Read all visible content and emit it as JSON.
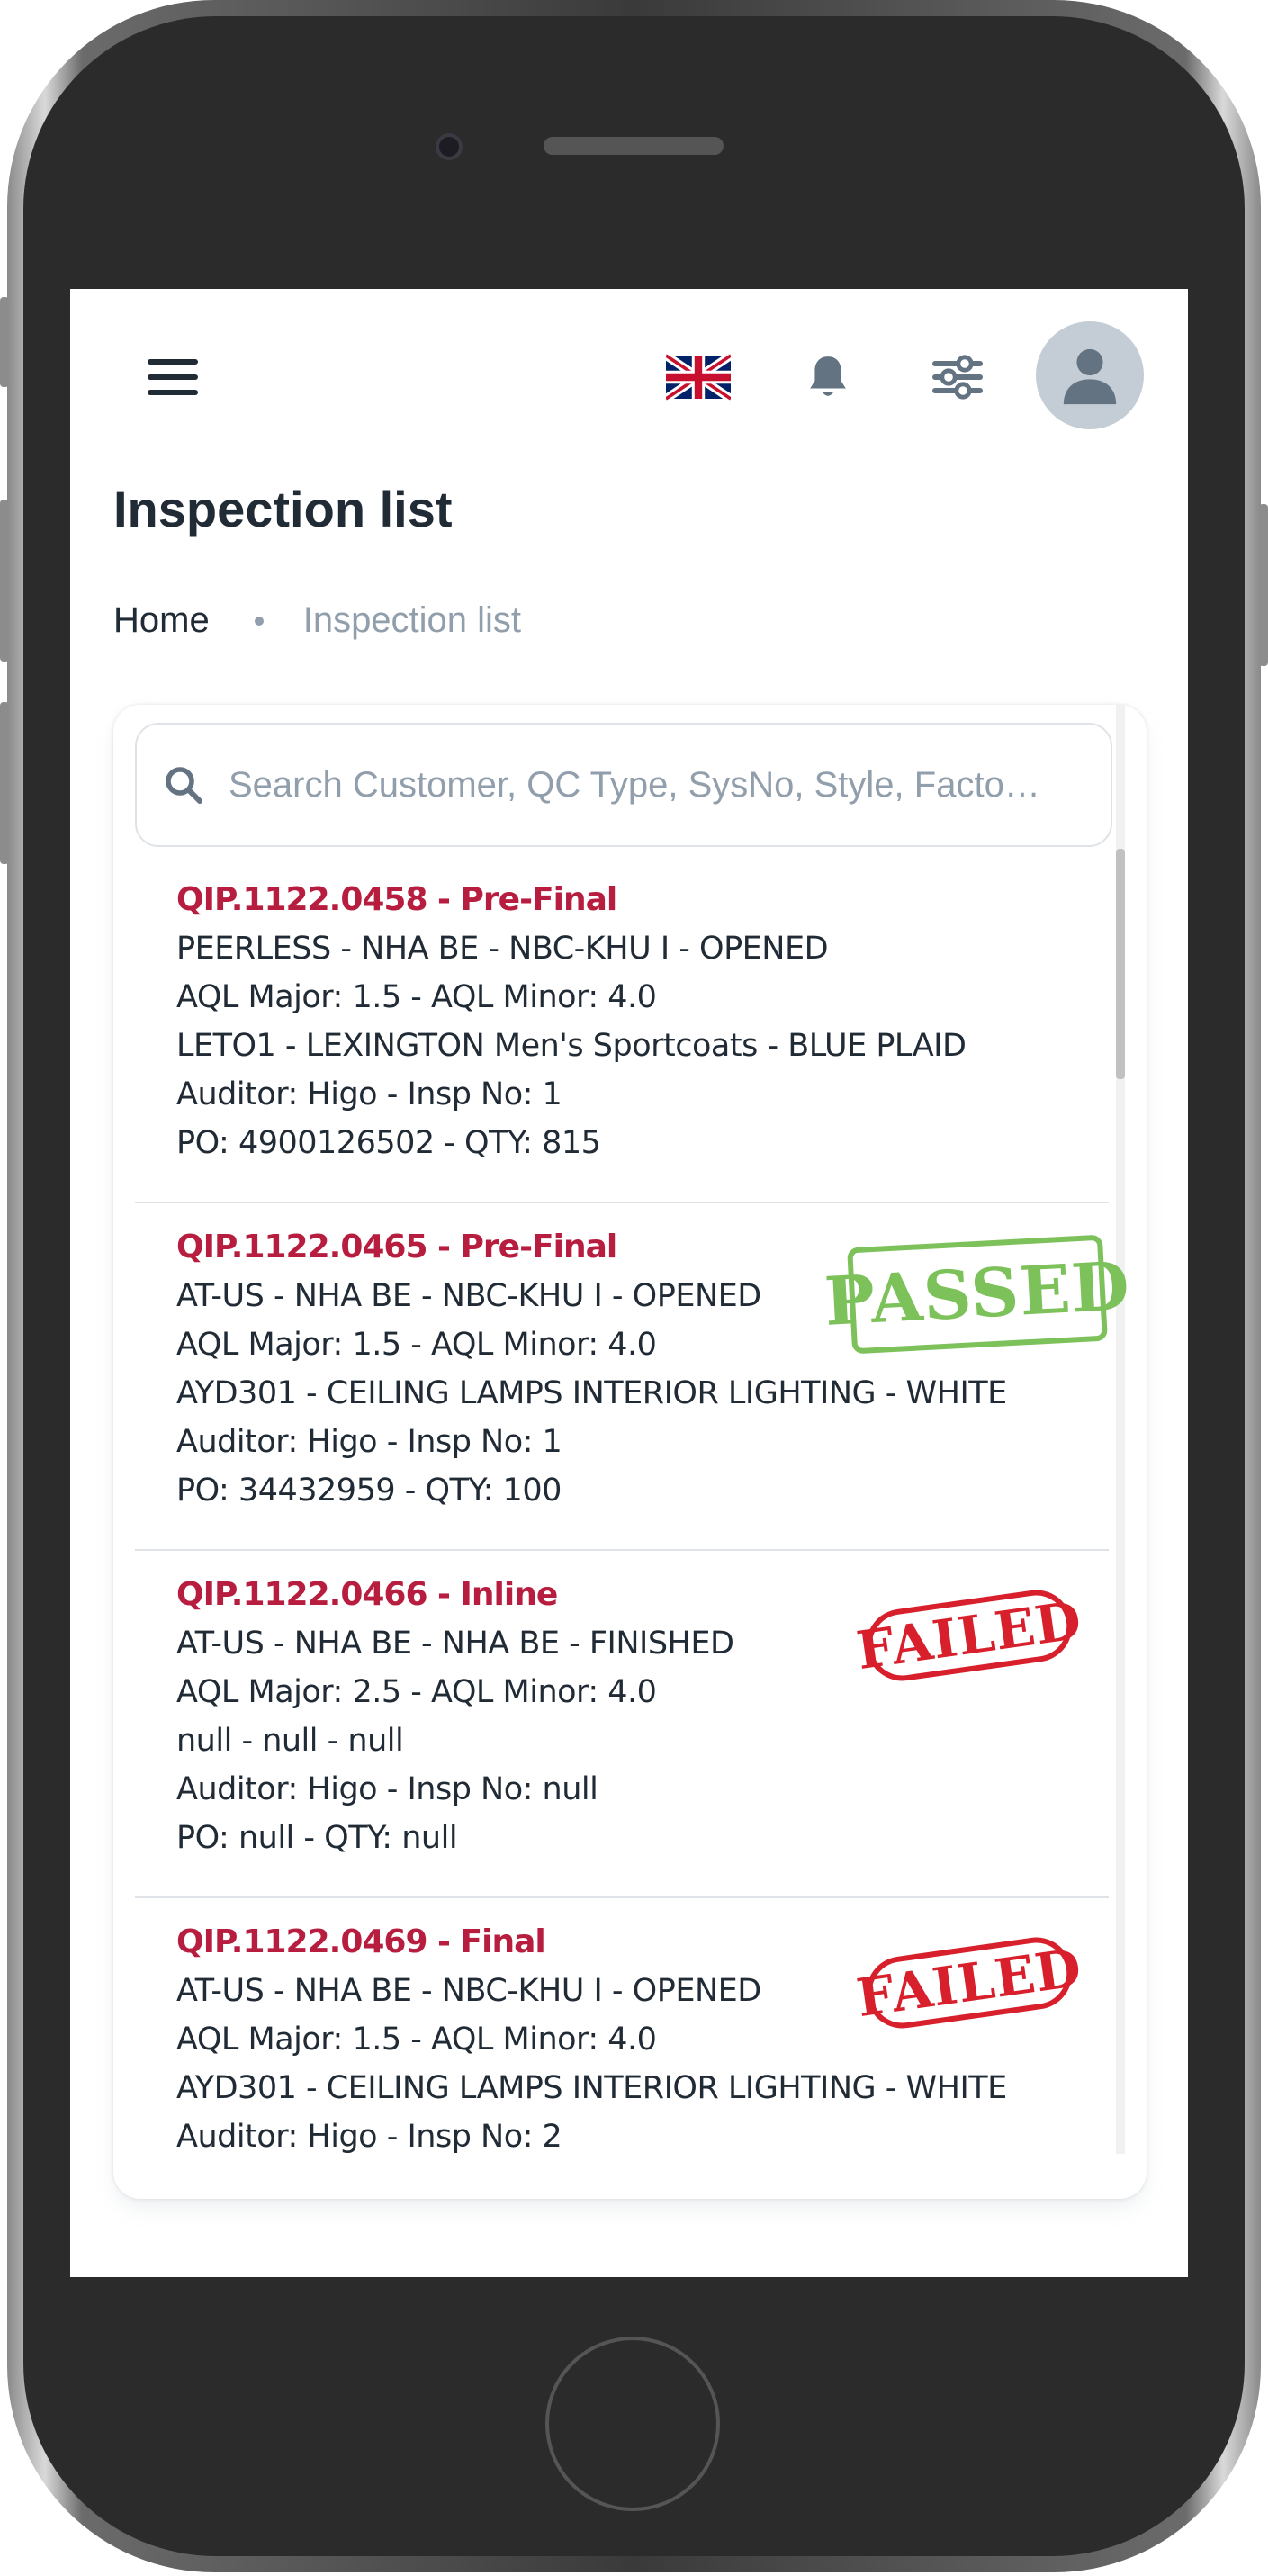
{
  "header": {
    "menu_icon": "hamburger-menu-icon",
    "flag_icon": "uk-flag-icon",
    "bell_icon": "bell-icon",
    "filter_icon": "sliders-icon",
    "avatar_icon": "user-avatar-icon"
  },
  "page": {
    "title": "Inspection list"
  },
  "breadcrumb": {
    "home": "Home",
    "current": "Inspection list"
  },
  "search": {
    "placeholder": "Search Customer, QC Type, SysNo, Style, Facto…",
    "value": ""
  },
  "colors": {
    "accent_red": "#b71d3f",
    "passed_green": "#7dc15a",
    "failed_red": "#d8202c",
    "text_primary": "#212b36",
    "text_secondary": "#919eab"
  },
  "inspections": [
    {
      "title": "QIP.1122.0458 - Pre-Final",
      "line1": "PEERLESS - NHA BE - NBC-KHU I - OPENED",
      "line2": "AQL Major: 1.5 - AQL Minor: 4.0",
      "line3": "LETO1 - LEXINGTON Men's Sportcoats - BLUE PLAID",
      "line4": "Auditor: Higo - Insp No: 1",
      "line5": "PO: 4900126502 - QTY: 815",
      "status": ""
    },
    {
      "title": "QIP.1122.0465 - Pre-Final",
      "line1": "AT-US - NHA BE - NBC-KHU I - OPENED",
      "line2": "AQL Major: 1.5 - AQL Minor: 4.0",
      "line3": "AYD301 - CEILING LAMPS INTERIOR LIGHTING - WHITE",
      "line4": "Auditor: Higo - Insp No: 1",
      "line5": "PO: 34432959 - QTY: 100",
      "status": "PASSED"
    },
    {
      "title": "QIP.1122.0466 - Inline",
      "line1": "AT-US - NHA BE - NHA BE - FINISHED",
      "line2": "AQL Major: 2.5 - AQL Minor: 4.0",
      "line3": "null - null - null",
      "line4": "Auditor: Higo - Insp No: null",
      "line5": "PO: null - QTY: null",
      "status": "FAILED"
    },
    {
      "title": "QIP.1122.0469 - Final",
      "line1": "AT-US - NHA BE - NBC-KHU I - OPENED",
      "line2": "AQL Major: 1.5 - AQL Minor: 4.0",
      "line3": "AYD301 - CEILING LAMPS INTERIOR LIGHTING - WHITE",
      "line4": "Auditor: Higo - Insp No: 2",
      "line5": "",
      "status": "FAILED"
    }
  ]
}
